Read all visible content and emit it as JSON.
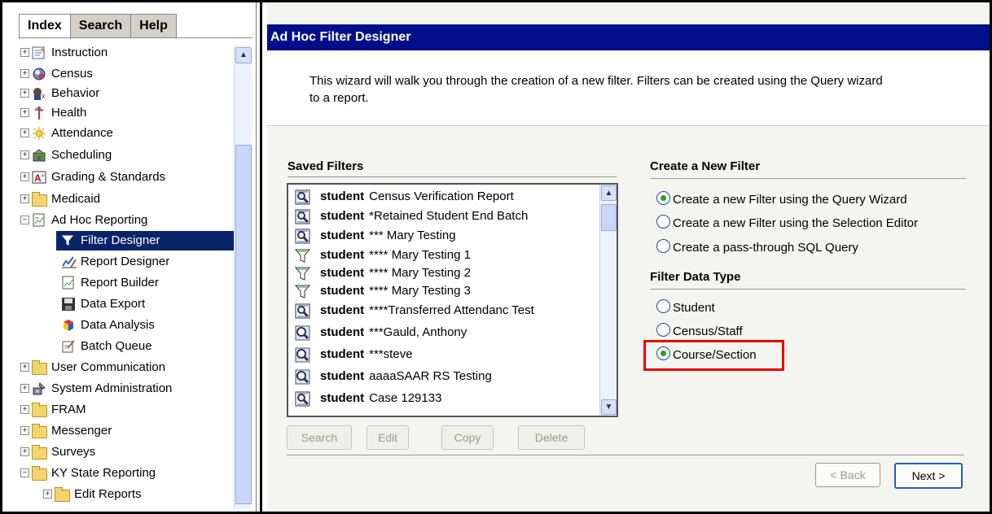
{
  "tabs": [
    "Index",
    "Search",
    "Help"
  ],
  "tree": [
    {
      "label": "Instruction",
      "exp": "+",
      "icon": "instruction-icon"
    },
    {
      "label": "Census",
      "exp": "+",
      "icon": "census-icon"
    },
    {
      "label": "Behavior",
      "exp": "+",
      "icon": "behavior-icon"
    },
    {
      "label": "Health",
      "exp": "+",
      "icon": "health-icon"
    },
    {
      "label": "Attendance",
      "exp": "+",
      "icon": "attendance-icon"
    },
    {
      "label": "Scheduling",
      "exp": "+",
      "icon": "scheduling-icon"
    },
    {
      "label": "Grading & Standards",
      "exp": "+",
      "icon": "grading-icon"
    },
    {
      "label": "Medicaid",
      "exp": "+",
      "icon": "folder-icon"
    },
    {
      "label": "Ad Hoc Reporting",
      "exp": "−",
      "icon": "report-icon"
    },
    {
      "label": "Filter Designer",
      "icon": "filter-icon",
      "selected": true
    },
    {
      "label": "Report Designer",
      "icon": "report-designer-icon"
    },
    {
      "label": "Report Builder",
      "icon": "report-builder-icon"
    },
    {
      "label": "Data Export",
      "icon": "disk-icon"
    },
    {
      "label": "Data Analysis",
      "icon": "cube-icon"
    },
    {
      "label": "Batch Queue",
      "icon": "batch-icon"
    },
    {
      "label": "User Communication",
      "exp": "+",
      "icon": "folder-icon"
    },
    {
      "label": "System Administration",
      "exp": "+",
      "icon": "system-admin-icon"
    },
    {
      "label": "FRAM",
      "exp": "+",
      "icon": "folder-icon"
    },
    {
      "label": "Messenger",
      "exp": "+",
      "icon": "folder-icon"
    },
    {
      "label": "Surveys",
      "exp": "+",
      "icon": "folder-icon"
    },
    {
      "label": "KY State Reporting",
      "exp": "−",
      "icon": "folder-icon"
    },
    {
      "label": "Edit Reports",
      "exp": "+",
      "icon": "folder-icon"
    }
  ],
  "main": {
    "title": "Ad Hoc Filter Designer",
    "intro_line1": "This wizard will walk you through the creation of a new filter. Filters can be created using the Query wizard",
    "intro_line2": "to a report.",
    "saved_filters_heading": "Saved Filters",
    "saved_filters": [
      {
        "type": "student",
        "name": "Census Verification Report",
        "icon": "query-icon"
      },
      {
        "type": "student",
        "name": "*Retained Student End Batch",
        "icon": "query-icon"
      },
      {
        "type": "student",
        "name": "*** Mary Testing",
        "icon": "query-icon"
      },
      {
        "type": "student",
        "name": "**** Mary Testing 1",
        "icon": "filter-funnel-icon"
      },
      {
        "type": "student",
        "name": "**** Mary Testing 2",
        "icon": "filter-funnel-icon"
      },
      {
        "type": "student",
        "name": "**** Mary Testing 3",
        "icon": "filter-funnel-icon"
      },
      {
        "type": "student",
        "name": "****Transferred Attendanc Test",
        "icon": "query-icon"
      },
      {
        "type": "student",
        "name": "***Gauld, Anthony",
        "icon": "selection-icon"
      },
      {
        "type": "student",
        "name": "***steve",
        "icon": "selection-icon"
      },
      {
        "type": "student",
        "name": "aaaaSAAR RS Testing",
        "icon": "selection-icon"
      },
      {
        "type": "student",
        "name": "Case 129133",
        "icon": "query-icon"
      }
    ],
    "buttons": {
      "search": "Search",
      "edit": "Edit",
      "copy": "Copy",
      "delete": "Delete"
    },
    "create_heading": "Create a New Filter",
    "create_options": [
      {
        "label": "Create a new Filter using the Query Wizard",
        "checked": true
      },
      {
        "label": "Create a new Filter using the Selection Editor",
        "checked": false
      },
      {
        "label": "Create a pass-through SQL Query",
        "checked": false
      }
    ],
    "type_heading": "Filter Data Type",
    "type_options": [
      {
        "label": "Student",
        "checked": false
      },
      {
        "label": "Census/Staff",
        "checked": false
      },
      {
        "label": "Course/Section",
        "checked": true
      }
    ],
    "back": "< Back",
    "next": "Next >"
  }
}
